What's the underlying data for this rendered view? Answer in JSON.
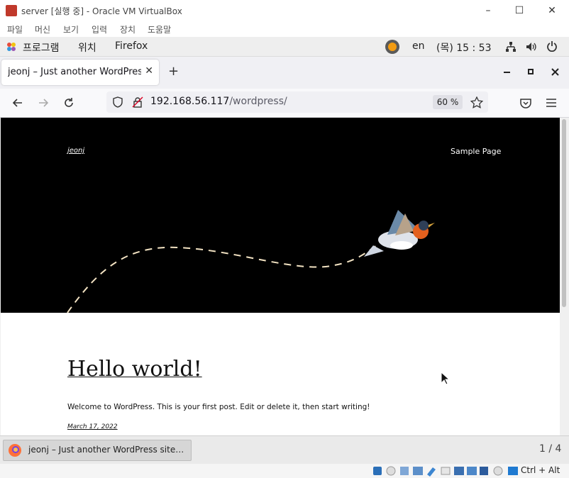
{
  "vbox": {
    "title": "server [실행 중] - Oracle VM VirtualBox",
    "menu": [
      "파일",
      "머신",
      "보기",
      "입력",
      "장치",
      "도움말"
    ],
    "host_key": "Ctrl + Alt"
  },
  "gnome": {
    "apps": "프로그램",
    "places": "위치",
    "firefox": "Firefox",
    "lang": "en",
    "clock": "(목) 15 : 53"
  },
  "firefox": {
    "tab_title": "jeonj – Just another WordPress site",
    "new_tab": "+",
    "url_host": "192.168.56.117",
    "url_path": "/wordpress/",
    "zoom": "60 %"
  },
  "site": {
    "name": "jeonj",
    "nav_item": "Sample Page",
    "post_title": "Hello world!",
    "post_excerpt": "Welcome to WordPress. This is your first post. Edit or delete it, then start writing!",
    "post_date": "March 17, 2022"
  },
  "taskbar": {
    "window_label": "jeonj – Just another WordPress site…",
    "workspace": "1 / 4"
  }
}
